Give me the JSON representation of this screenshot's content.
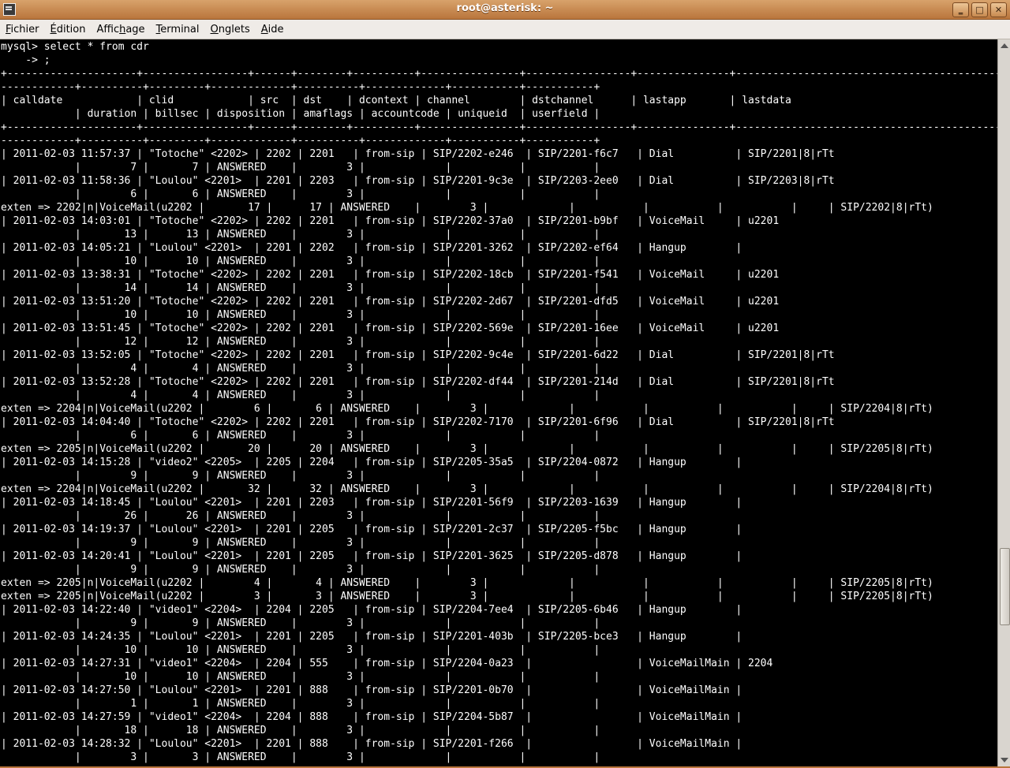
{
  "window": {
    "title": "root@asterisk: ~"
  },
  "menu": [
    {
      "pre": "",
      "key": "F",
      "post": "ichier"
    },
    {
      "pre": "",
      "key": "É",
      "post": "dition"
    },
    {
      "pre": "Affic",
      "key": "h",
      "post": "age"
    },
    {
      "pre": "",
      "key": "T",
      "post": "erminal"
    },
    {
      "pre": "",
      "key": "O",
      "post": "nglets"
    },
    {
      "pre": "",
      "key": "A",
      "post": "ide"
    }
  ],
  "terminal": {
    "lines": [
      "mysql> select * from cdr",
      "    -> ;",
      "+---------------------+-----------------+------+--------+----------+----------------+-----------------+---------------+--------------------------------------------------------------",
      "------------+----------+---------+-------------+----------+-------------+-----------+-----------+",
      "| calldate            | clid            | src  | dst    | dcontext | channel        | dstchannel      | lastapp       | lastdata",
      "            | duration | billsec | disposition | amaflags | accountcode | uniqueid  | userfield |",
      "+---------------------+-----------------+------+--------+----------+----------------+-----------------+---------------+--------------------------------------------------------------",
      "------------+----------+---------+-------------+----------+-------------+-----------+-----------+",
      "| 2011-02-03 11:57:37 | \"Totoche\" <2202> | 2202 | 2201   | from-sip | SIP/2202-e246  | SIP/2201-f6c7   | Dial          | SIP/2201|8|rTt",
      "            |        7 |       7 | ANSWERED    |        3 |             |           |           |",
      "| 2011-02-03 11:58:36 | \"Loulou\" <2201>  | 2201 | 2203   | from-sip | SIP/2201-9c3e  | SIP/2203-2ee0   | Dial          | SIP/2203|8|rTt",
      "            |        6 |       6 | ANSWERED    |        3 |             |           |           |",
      "exten => 2202|n|VoiceMail(u2202 |       17 |      17 | ANSWERED    |        3 |             |           |           |           |     | SIP/2202|8|rTt)",
      "| 2011-02-03 14:03:01 | \"Totoche\" <2202> | 2202 | 2201   | from-sip | SIP/2202-37a0  | SIP/2201-b9bf   | VoiceMail     | u2201",
      "            |       13 |      13 | ANSWERED    |        3 |             |           |           |",
      "| 2011-02-03 14:05:21 | \"Loulou\" <2201>  | 2201 | 2202   | from-sip | SIP/2201-3262  | SIP/2202-ef64   | Hangup        |",
      "            |       10 |      10 | ANSWERED    |        3 |             |           |           |",
      "| 2011-02-03 13:38:31 | \"Totoche\" <2202> | 2202 | 2201   | from-sip | SIP/2202-18cb  | SIP/2201-f541   | VoiceMail     | u2201",
      "            |       14 |      14 | ANSWERED    |        3 |             |           |           |",
      "| 2011-02-03 13:51:20 | \"Totoche\" <2202> | 2202 | 2201   | from-sip | SIP/2202-2d67  | SIP/2201-dfd5   | VoiceMail     | u2201",
      "            |       10 |      10 | ANSWERED    |        3 |             |           |           |",
      "| 2011-02-03 13:51:45 | \"Totoche\" <2202> | 2202 | 2201   | from-sip | SIP/2202-569e  | SIP/2201-16ee   | VoiceMail     | u2201",
      "            |       12 |      12 | ANSWERED    |        3 |             |           |           |",
      "| 2011-02-03 13:52:05 | \"Totoche\" <2202> | 2202 | 2201   | from-sip | SIP/2202-9c4e  | SIP/2201-6d22   | Dial          | SIP/2201|8|rTt",
      "            |        4 |       4 | ANSWERED    |        3 |             |           |           |",
      "| 2011-02-03 13:52:28 | \"Totoche\" <2202> | 2202 | 2201   | from-sip | SIP/2202-df44  | SIP/2201-214d   | Dial          | SIP/2201|8|rTt",
      "            |        4 |       4 | ANSWERED    |        3 |             |           |           |",
      "exten => 2204|n|VoiceMail(u2202 |        6 |       6 | ANSWERED    |        3 |             |           |           |           |     | SIP/2204|8|rTt)",
      "| 2011-02-03 14:04:40 | \"Totoche\" <2202> | 2202 | 2201   | from-sip | SIP/2202-7170  | SIP/2201-6f96   | Dial          | SIP/2201|8|rTt",
      "            |        6 |       6 | ANSWERED    |        3 |             |           |           |",
      "exten => 2205|n|VoiceMail(u2202 |       20 |      20 | ANSWERED    |        3 |             |           |           |           |     | SIP/2205|8|rTt)",
      "| 2011-02-03 14:15:28 | \"video2\" <2205>  | 2205 | 2204   | from-sip | SIP/2205-35a5  | SIP/2204-0872   | Hangup        |",
      "            |        9 |       9 | ANSWERED    |        3 |             |           |           |",
      "exten => 2204|n|VoiceMail(u2202 |       32 |      32 | ANSWERED    |        3 |             |           |           |           |     | SIP/2204|8|rTt)",
      "| 2011-02-03 14:18:45 | \"Loulou\" <2201>  | 2201 | 2203   | from-sip | SIP/2201-56f9  | SIP/2203-1639   | Hangup        |",
      "            |       26 |      26 | ANSWERED    |        3 |             |           |           |",
      "| 2011-02-03 14:19:37 | \"Loulou\" <2201>  | 2201 | 2205   | from-sip | SIP/2201-2c37  | SIP/2205-f5bc   | Hangup        |",
      "            |        9 |       9 | ANSWERED    |        3 |             |           |           |",
      "| 2011-02-03 14:20:41 | \"Loulou\" <2201>  | 2201 | 2205   | from-sip | SIP/2201-3625  | SIP/2205-d878   | Hangup        |",
      "            |        9 |       9 | ANSWERED    |        3 |             |           |           |",
      "exten => 2205|n|VoiceMail(u2202 |        4 |       4 | ANSWERED    |        3 |             |           |           |           |     | SIP/2205|8|rTt)",
      "exten => 2205|n|VoiceMail(u2202 |        3 |       3 | ANSWERED    |        3 |             |           |           |           |     | SIP/2205|8|rTt)",
      "| 2011-02-03 14:22:40 | \"video1\" <2204>  | 2204 | 2205   | from-sip | SIP/2204-7ee4  | SIP/2205-6b46   | Hangup        |",
      "            |        9 |       9 | ANSWERED    |        3 |             |           |           |",
      "| 2011-02-03 14:24:35 | \"Loulou\" <2201>  | 2201 | 2205   | from-sip | SIP/2201-403b  | SIP/2205-bce3   | Hangup        |",
      "            |       10 |      10 | ANSWERED    |        3 |             |           |           |",
      "| 2011-02-03 14:27:31 | \"video1\" <2204>  | 2204 | 555    | from-sip | SIP/2204-0a23  |                 | VoiceMailMain | 2204",
      "            |       10 |      10 | ANSWERED    |        3 |             |           |           |",
      "| 2011-02-03 14:27:50 | \"Loulou\" <2201>  | 2201 | 888    | from-sip | SIP/2201-0b70  |                 | VoiceMailMain |",
      "            |        1 |       1 | ANSWERED    |        3 |             |           |           |",
      "| 2011-02-03 14:27:59 | \"video1\" <2204>  | 2204 | 888    | from-sip | SIP/2204-5b87  |                 | VoiceMailMain |",
      "            |       18 |      18 | ANSWERED    |        3 |             |           |           |",
      "| 2011-02-03 14:28:32 | \"Loulou\" <2201>  | 2201 | 888    | from-sip | SIP/2201-f266  |                 | VoiceMailMain |",
      "            |        3 |       3 | ANSWERED    |        3 |             |           |           |"
    ]
  }
}
